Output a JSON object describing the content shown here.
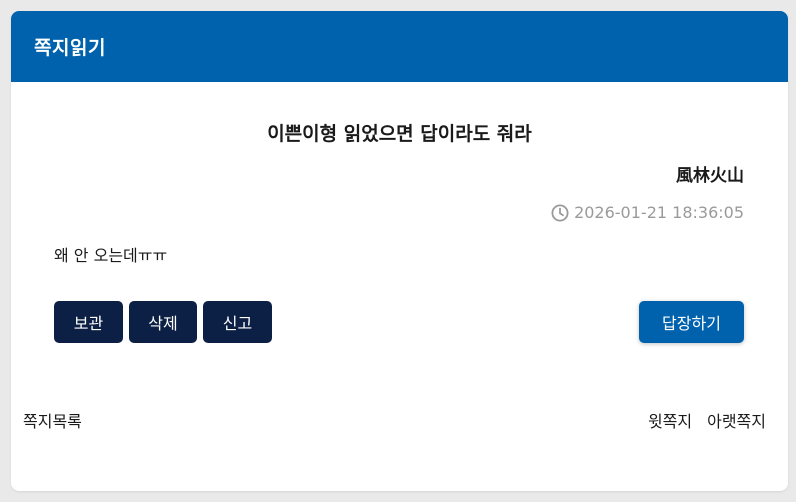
{
  "header": {
    "title": "쪽지읽기"
  },
  "message": {
    "subject": "이쁜이형 읽었으면 답이라도 줘라",
    "sender": "風林火山",
    "datetime": "2026-01-21 18:36:05",
    "body": "왜 안 오는데ㅠㅠ"
  },
  "actions": {
    "save_label": "보관",
    "delete_label": "삭제",
    "report_label": "신고",
    "reply_label": "답장하기"
  },
  "navigation": {
    "list_label": "쪽지목록",
    "prev_label": "윗쪽지",
    "next_label": "아랫쪽지"
  },
  "colors": {
    "header_bg": "#0062ad",
    "dark_button": "#0c1f45",
    "reply_button": "#0062ad"
  },
  "icons": {
    "datetime": "clock-icon"
  }
}
